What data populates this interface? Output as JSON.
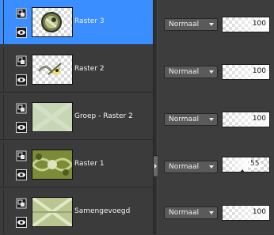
{
  "layers": [
    {
      "name": "Raster 3",
      "selected": true,
      "blend_mode": "Normaal",
      "opacity": "100"
    },
    {
      "name": "Raster 2",
      "selected": false,
      "blend_mode": "Normaal",
      "opacity": "100"
    },
    {
      "name": "Groep - Raster 2",
      "selected": false,
      "blend_mode": "Normaal",
      "opacity": "100"
    },
    {
      "name": "Raster 1",
      "selected": false,
      "blend_mode": "Normaal",
      "opacity": "55"
    },
    {
      "name": "Samengevoegd",
      "selected": false,
      "blend_mode": "Normaal",
      "opacity": "100"
    }
  ],
  "colors": {
    "selection": "#3a8eff",
    "panel": "#3b3b3b"
  }
}
